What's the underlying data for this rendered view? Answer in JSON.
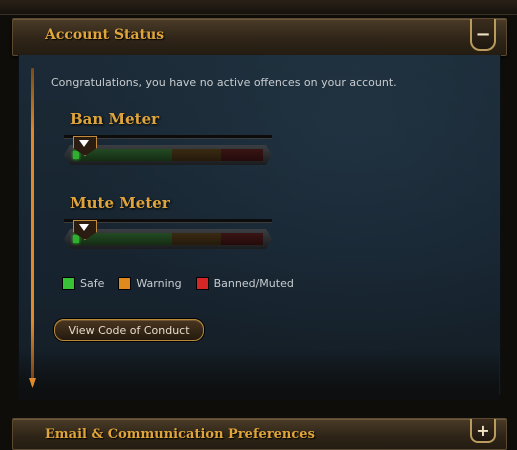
{
  "account_status": {
    "title": "Account Status",
    "toggle_symbol": "−",
    "message": "Congratulations, you have no active offences on your account.",
    "meters": [
      {
        "title": "Ban Meter",
        "level": 0.03
      },
      {
        "title": "Mute Meter",
        "level": 0.03
      }
    ],
    "legend": [
      {
        "label": "Safe",
        "color": "#37c237"
      },
      {
        "label": "Warning",
        "color": "#e08a1e"
      },
      {
        "label": "Banned/Muted",
        "color": "#d42626"
      }
    ],
    "code_of_conduct_button": "View Code of Conduct"
  },
  "email_prefs": {
    "title": "Email & Communication Preferences",
    "toggle_symbol": "+"
  },
  "colors": {
    "accent": "#e0a53a",
    "panel": "#1b2a36"
  }
}
